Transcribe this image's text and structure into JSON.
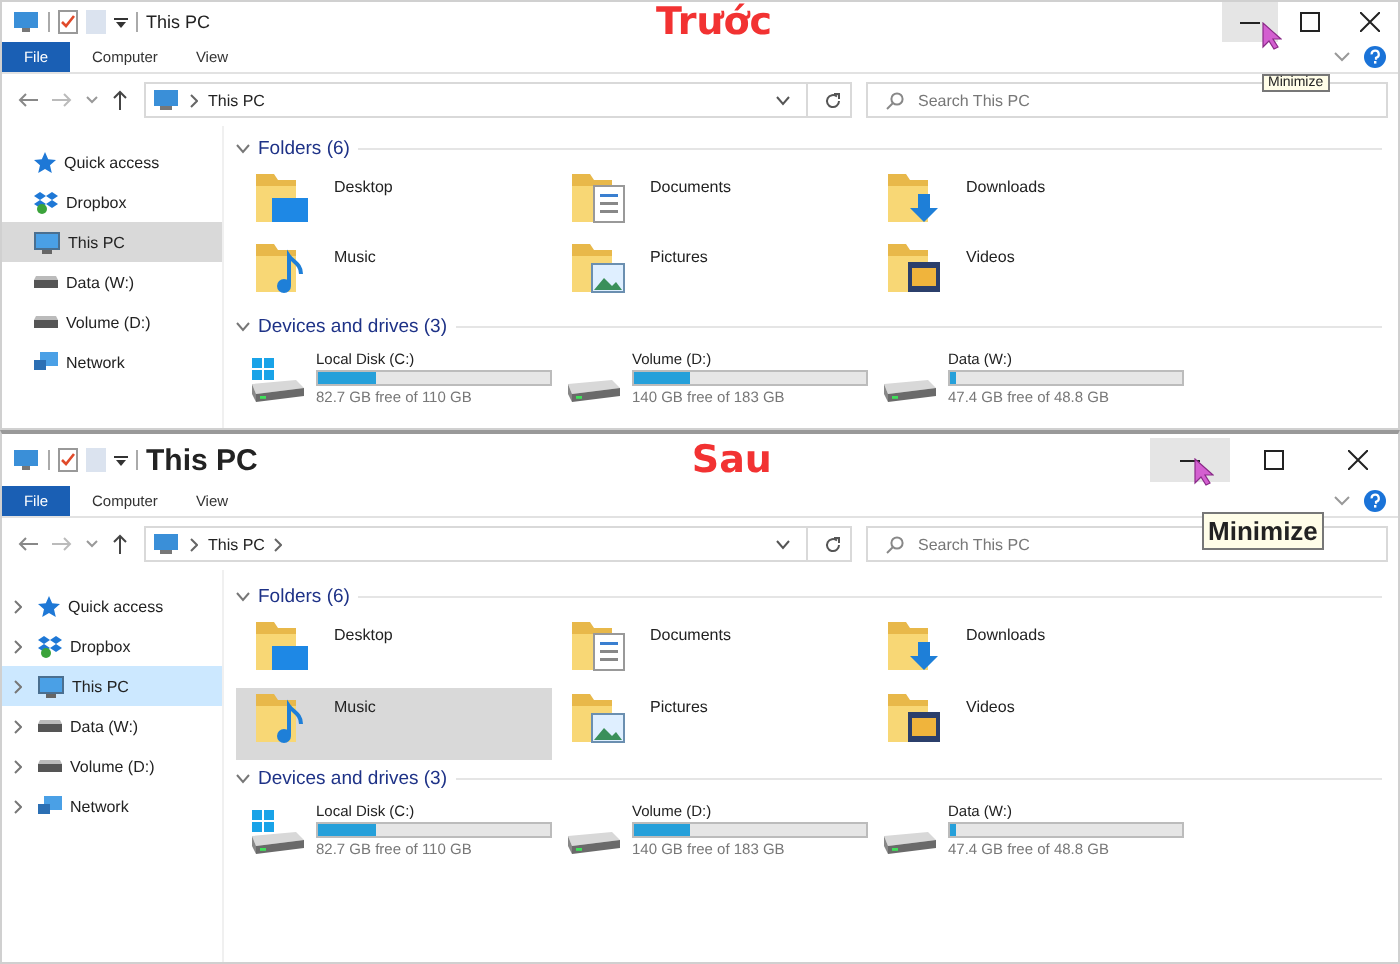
{
  "panels": [
    {
      "label": "Trước",
      "title": "This PC",
      "large_title": false,
      "file_tab": "File",
      "tabs": [
        "Computer",
        "View"
      ],
      "controls": [
        {
          "kind": "minimize",
          "hovered": true
        },
        {
          "kind": "maximize",
          "hovered": false
        },
        {
          "kind": "close",
          "hovered": false
        }
      ],
      "tooltip": {
        "text": "Minimize",
        "large": false
      },
      "address": {
        "crumb": "This PC",
        "trailing_chevron": false
      },
      "search": {
        "placeholder": "Search This PC"
      },
      "expanders": false,
      "focused_selection": false,
      "nav": [
        {
          "kind": "star",
          "label": "Quick access",
          "selected": false
        },
        {
          "kind": "dropbox",
          "label": "Dropbox",
          "selected": false
        },
        {
          "kind": "pc",
          "label": "This PC",
          "selected": true
        },
        {
          "kind": "drive",
          "label": "Data (W:)",
          "selected": false
        },
        {
          "kind": "drive",
          "label": "Volume (D:)",
          "selected": false
        },
        {
          "kind": "network",
          "label": "Network",
          "selected": false
        }
      ],
      "folders_header": "Folders (6)",
      "folders": [
        {
          "kind": "desktop",
          "name": "Desktop",
          "hovered": false
        },
        {
          "kind": "documents",
          "name": "Documents",
          "hovered": false
        },
        {
          "kind": "downloads",
          "name": "Downloads",
          "hovered": false
        },
        {
          "kind": "music",
          "name": "Music",
          "hovered": false
        },
        {
          "kind": "pictures",
          "name": "Pictures",
          "hovered": false
        },
        {
          "kind": "videos",
          "name": "Videos",
          "hovered": false
        }
      ],
      "drives_header": "Devices and drives (3)",
      "drives": [
        {
          "kind": "system",
          "name": "Local Disk (C:)",
          "level": 0.25,
          "free": "82.7 GB free of 110 GB"
        },
        {
          "kind": "drive",
          "name": "Volume (D:)",
          "level": 0.24,
          "free": "140 GB free of 183 GB"
        },
        {
          "kind": "drive",
          "name": "Data (W:)",
          "level": 0.03,
          "free": "47.4 GB free of 48.8 GB"
        }
      ]
    },
    {
      "label": "Sau",
      "title": "This PC",
      "large_title": true,
      "file_tab": "File",
      "tabs": [
        "Computer",
        "View"
      ],
      "controls": [
        {
          "kind": "minimize",
          "hovered": true
        },
        {
          "kind": "maximize",
          "hovered": false
        },
        {
          "kind": "close",
          "hovered": false
        }
      ],
      "tooltip": {
        "text": "Minimize",
        "large": true
      },
      "address": {
        "crumb": "This PC",
        "trailing_chevron": true
      },
      "search": {
        "placeholder": "Search This PC"
      },
      "expanders": true,
      "focused_selection": true,
      "nav": [
        {
          "kind": "star",
          "label": "Quick access",
          "selected": false
        },
        {
          "kind": "dropbox",
          "label": "Dropbox",
          "selected": false
        },
        {
          "kind": "pc",
          "label": "This PC",
          "selected": true
        },
        {
          "kind": "drive",
          "label": "Data (W:)",
          "selected": false
        },
        {
          "kind": "drive",
          "label": "Volume (D:)",
          "selected": false
        },
        {
          "kind": "network",
          "label": "Network",
          "selected": false
        }
      ],
      "folders_header": "Folders (6)",
      "folders": [
        {
          "kind": "desktop",
          "name": "Desktop",
          "hovered": false
        },
        {
          "kind": "documents",
          "name": "Documents",
          "hovered": false
        },
        {
          "kind": "downloads",
          "name": "Downloads",
          "hovered": false
        },
        {
          "kind": "music",
          "name": "Music",
          "hovered": true
        },
        {
          "kind": "pictures",
          "name": "Pictures",
          "hovered": false
        },
        {
          "kind": "videos",
          "name": "Videos",
          "hovered": false
        }
      ],
      "drives_header": "Devices and drives (3)",
      "drives": [
        {
          "kind": "system",
          "name": "Local Disk (C:)",
          "level": 0.25,
          "free": "82.7 GB free of 110 GB"
        },
        {
          "kind": "drive",
          "name": "Volume (D:)",
          "level": 0.24,
          "free": "140 GB free of 183 GB"
        },
        {
          "kind": "drive",
          "name": "Data (W:)",
          "level": 0.03,
          "free": "47.4 GB free of 48.8 GB"
        }
      ]
    }
  ]
}
